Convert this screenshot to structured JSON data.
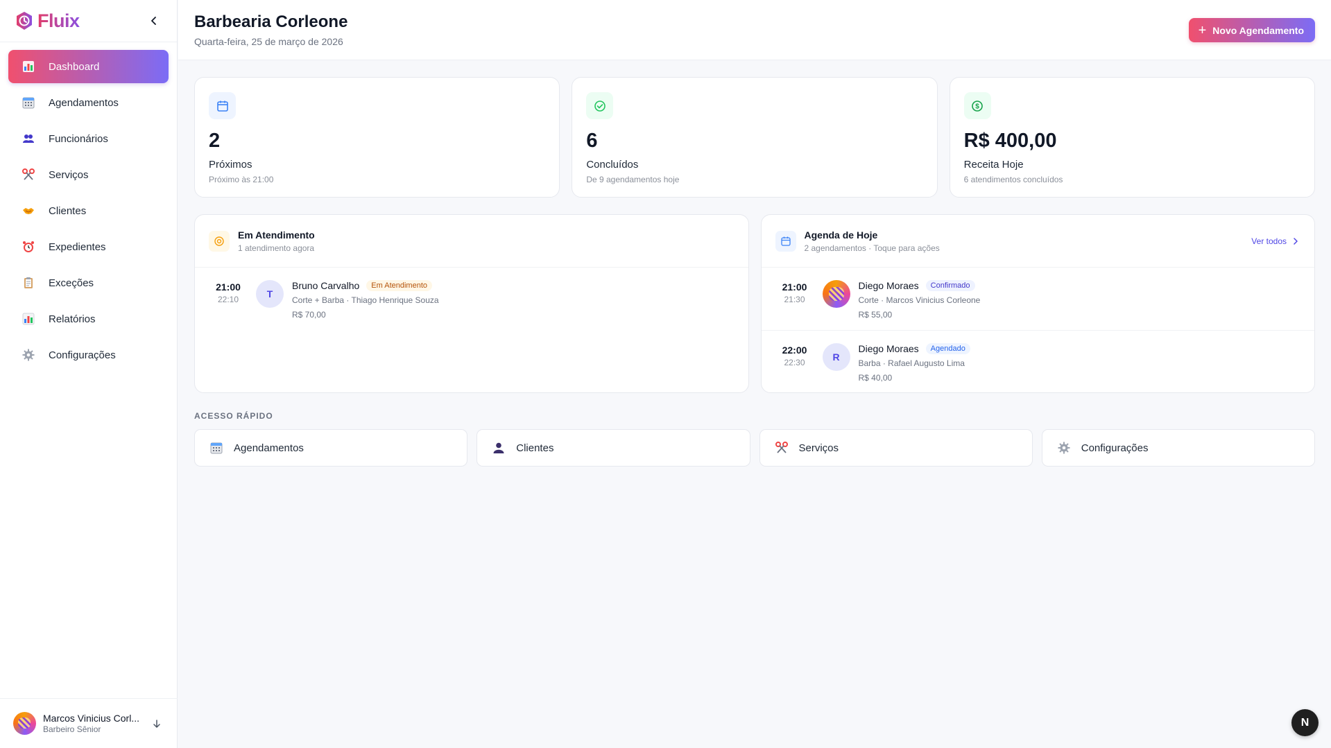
{
  "brand": {
    "name": "Fluix",
    "logo_icon": "clock-shield-icon"
  },
  "sidebar": {
    "items": [
      {
        "label": "Dashboard",
        "icon": "bar-chart-icon",
        "active": true
      },
      {
        "label": "Agendamentos",
        "icon": "calendar-icon"
      },
      {
        "label": "Funcionários",
        "icon": "people-icon"
      },
      {
        "label": "Serviços",
        "icon": "scissors-icon"
      },
      {
        "label": "Clientes",
        "icon": "handshake-icon"
      },
      {
        "label": "Expedientes",
        "icon": "alarm-clock-icon"
      },
      {
        "label": "Exceções",
        "icon": "clipboard-icon"
      },
      {
        "label": "Relatórios",
        "icon": "bar-chart-icon"
      },
      {
        "label": "Configurações",
        "icon": "gear-icon"
      }
    ]
  },
  "user": {
    "name": "Marcos Vinicius Corl...",
    "role": "Barbeiro Sênior"
  },
  "header": {
    "title": "Barbearia Corleone",
    "date": "Quarta-feira, 25 de março de 2026",
    "new_button": "Novo Agendamento"
  },
  "stats": [
    {
      "value": "2",
      "label": "Próximos",
      "sub": "Próximo às 21:00",
      "icon": "calendar-icon",
      "color": "#3b82f6"
    },
    {
      "value": "6",
      "label": "Concluídos",
      "sub": "De 9 agendamentos hoje",
      "icon": "check-circle-icon",
      "color": "#22c55e"
    },
    {
      "value": "R$ 400,00",
      "label": "Receita Hoje",
      "sub": "6 atendimentos concluídos",
      "icon": "dollar-icon",
      "color": "#16a34a"
    }
  ],
  "in_service": {
    "title": "Em Atendimento",
    "subtitle": "1 atendimento agora",
    "items": [
      {
        "start": "21:00",
        "end": "22:10",
        "initial": "T",
        "name": "Bruno Carvalho",
        "badge": "Em Atendimento",
        "detail": "Corte + Barba · Thiago Henrique Souza",
        "price": "R$ 70,00"
      }
    ]
  },
  "today": {
    "title": "Agenda de Hoje",
    "subtitle": "2 agendamentos · Toque para ações",
    "see_all": "Ver todos",
    "items": [
      {
        "start": "21:00",
        "end": "21:30",
        "initial": "",
        "name": "Diego Moraes",
        "badge": "Confirmado",
        "detail": "Corte · Marcos Vinicius Corleone",
        "price": "R$ 55,00"
      },
      {
        "start": "22:00",
        "end": "22:30",
        "initial": "R",
        "name": "Diego Moraes",
        "badge": "Agendado",
        "detail": "Barba · Rafael Augusto Lima",
        "price": "R$ 40,00"
      }
    ]
  },
  "quick_access": {
    "title": "ACESSO RÁPIDO",
    "items": [
      {
        "label": "Agendamentos",
        "icon": "calendar-icon"
      },
      {
        "label": "Clientes",
        "icon": "person-icon"
      },
      {
        "label": "Serviços",
        "icon": "scissors-icon"
      },
      {
        "label": "Configurações",
        "icon": "gear-icon"
      }
    ]
  },
  "dev_badge": "N"
}
